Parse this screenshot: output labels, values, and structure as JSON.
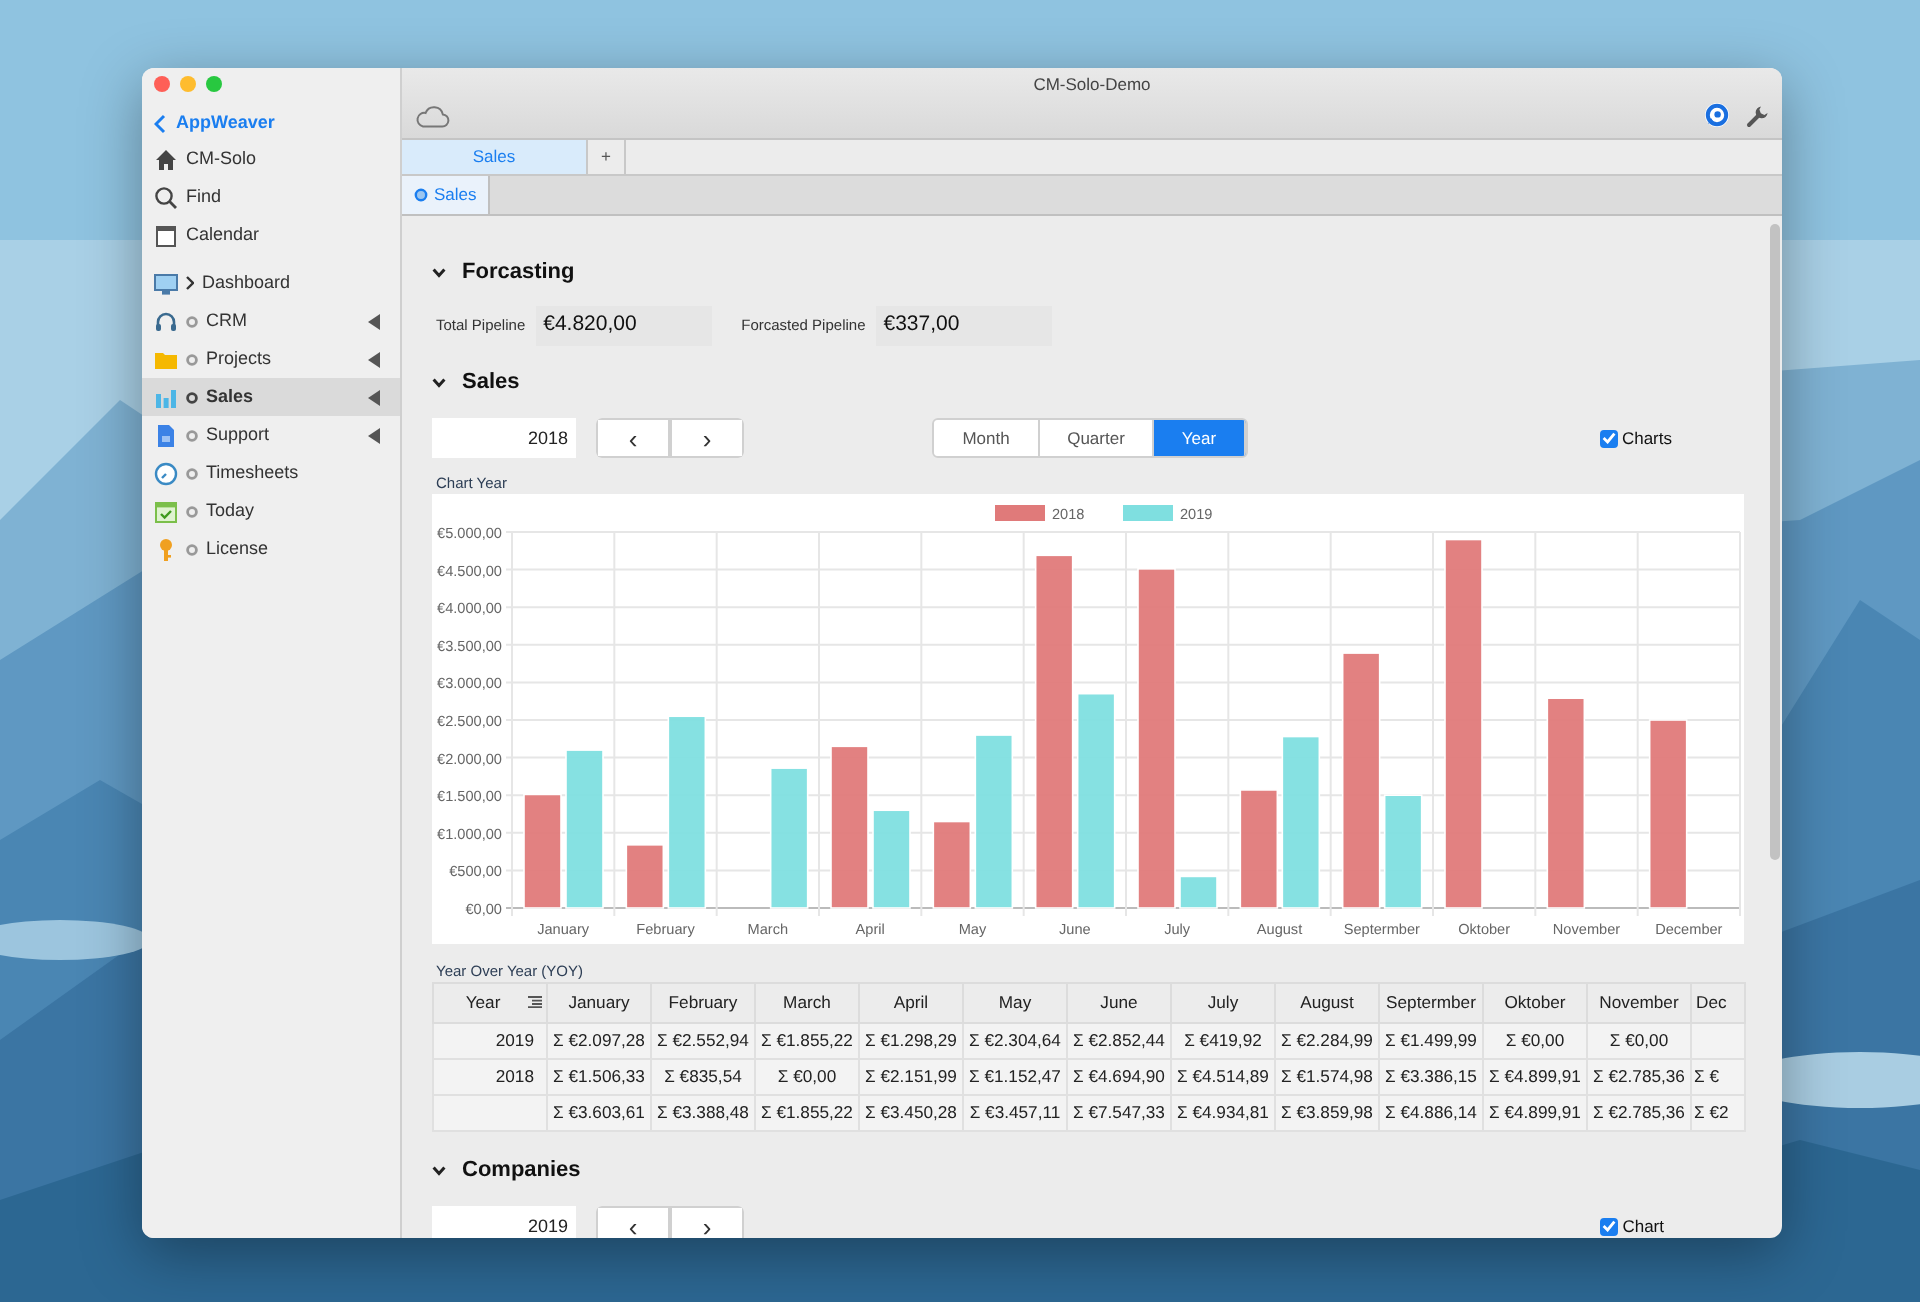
{
  "window": {
    "title": "CM-Solo-Demo"
  },
  "sidebar": {
    "back_link": "AppWeaver",
    "top_items": [
      {
        "label": "CM-Solo"
      },
      {
        "label": "Find"
      },
      {
        "label": "Calendar"
      }
    ],
    "modules": [
      {
        "label": "Dashboard",
        "kind": "group",
        "submenu": false,
        "selected": false
      },
      {
        "label": "CRM",
        "kind": "module",
        "submenu": true,
        "selected": false
      },
      {
        "label": "Projects",
        "kind": "module",
        "submenu": true,
        "selected": false
      },
      {
        "label": "Sales",
        "kind": "module",
        "submenu": true,
        "selected": true
      },
      {
        "label": "Support",
        "kind": "module",
        "submenu": true,
        "selected": false
      },
      {
        "label": "Timesheets",
        "kind": "module",
        "submenu": false,
        "selected": false
      },
      {
        "label": "Today",
        "kind": "module",
        "submenu": false,
        "selected": false
      },
      {
        "label": "License",
        "kind": "module",
        "submenu": false,
        "selected": false
      }
    ]
  },
  "tabs": [
    {
      "label": "Sales",
      "selected": true
    },
    {
      "label": "+",
      "selected": false
    }
  ],
  "subtabs": [
    {
      "label": "Sales",
      "selected": true
    }
  ],
  "forcasting": {
    "title": "Forcasting",
    "expanded": true,
    "fields": [
      {
        "label": "Total Pipeline",
        "value": "€4.820,00"
      },
      {
        "label": "Forcasted Pipeline",
        "value": "€337,00"
      }
    ]
  },
  "sales": {
    "title": "Sales",
    "expanded": true,
    "year": "2018",
    "prev": "‹",
    "next": "›",
    "periods": [
      {
        "label": "Month",
        "selected": false
      },
      {
        "label": "Quarter",
        "selected": false
      },
      {
        "label": "Year",
        "selected": true
      }
    ],
    "charts_toggle": {
      "label": "Charts",
      "checked": true
    },
    "chart_title": "Chart Year",
    "chart_data": {
      "type": "bar",
      "categories": [
        "January",
        "February",
        "March",
        "April",
        "May",
        "June",
        "July",
        "August",
        "Septermber",
        "Oktober",
        "November",
        "December"
      ],
      "series": [
        {
          "name": "2018",
          "color": "#e07a7a",
          "values": [
            1510,
            840,
            0,
            2150,
            1150,
            4690,
            4510,
            1570,
            3390,
            4900,
            2790,
            2500
          ]
        },
        {
          "name": "2019",
          "color": "#7fdfe0",
          "values": [
            2100,
            2550,
            1860,
            1300,
            2300,
            2850,
            420,
            2280,
            1500,
            0,
            0,
            null
          ]
        }
      ],
      "grid": true,
      "legend": true,
      "ylim": [
        0,
        5000
      ],
      "yticks": [
        {
          "value": 0,
          "label": "€0,00"
        },
        {
          "value": 500,
          "label": "€500,00"
        },
        {
          "value": 1000,
          "label": "€1.000,00"
        },
        {
          "value": 1500,
          "label": "€1.500,00"
        },
        {
          "value": 2000,
          "label": "€2.000,00"
        },
        {
          "value": 2500,
          "label": "€2.500,00"
        },
        {
          "value": 3000,
          "label": "€3.000,00"
        },
        {
          "value": 3500,
          "label": "€3.500,00"
        },
        {
          "value": 4000,
          "label": "€4.000,00"
        },
        {
          "value": 4500,
          "label": "€4.500,00"
        },
        {
          "value": 5000,
          "label": "€5.000,00"
        }
      ]
    },
    "table_title": "Year Over Year (YOY)",
    "table": {
      "columns": [
        "Year",
        "January",
        "February",
        "March",
        "April",
        "May",
        "June",
        "July",
        "August",
        "Septermber",
        "Oktober",
        "November",
        "Dec"
      ],
      "rows": [
        {
          "cells": [
            "2019",
            "Σ €2.097,28",
            "Σ €2.552,94",
            "Σ €1.855,22",
            "Σ €1.298,29",
            "Σ €2.304,64",
            "Σ €2.852,44",
            "Σ €419,92",
            "Σ €2.284,99",
            "Σ €1.499,99",
            "Σ €0,00",
            "Σ €0,00"
          ]
        },
        {
          "cells": [
            "2018",
            "Σ €1.506,33",
            "Σ €835,54",
            "Σ €0,00",
            "Σ €2.151,99",
            "Σ €1.152,47",
            "Σ €4.694,90",
            "Σ €4.514,89",
            "Σ €1.574,98",
            "Σ €3.386,15",
            "Σ €4.899,91",
            "Σ €2.785,36",
            "Σ €"
          ]
        },
        {
          "cells": [
            "",
            "Σ €3.603,61",
            "Σ €3.388,48",
            "Σ €1.855,22",
            "Σ €3.450,28",
            "Σ €3.457,11",
            "Σ €7.547,33",
            "Σ €4.934,81",
            "Σ €3.859,98",
            "Σ €4.886,14",
            "Σ €4.899,91",
            "Σ €2.785,36",
            "Σ €2"
          ]
        }
      ]
    }
  },
  "companies": {
    "title": "Companies",
    "expanded": true,
    "year": "2019",
    "prev": "‹",
    "next": "›",
    "chart_toggle": {
      "label": "Chart",
      "checked": true
    }
  }
}
